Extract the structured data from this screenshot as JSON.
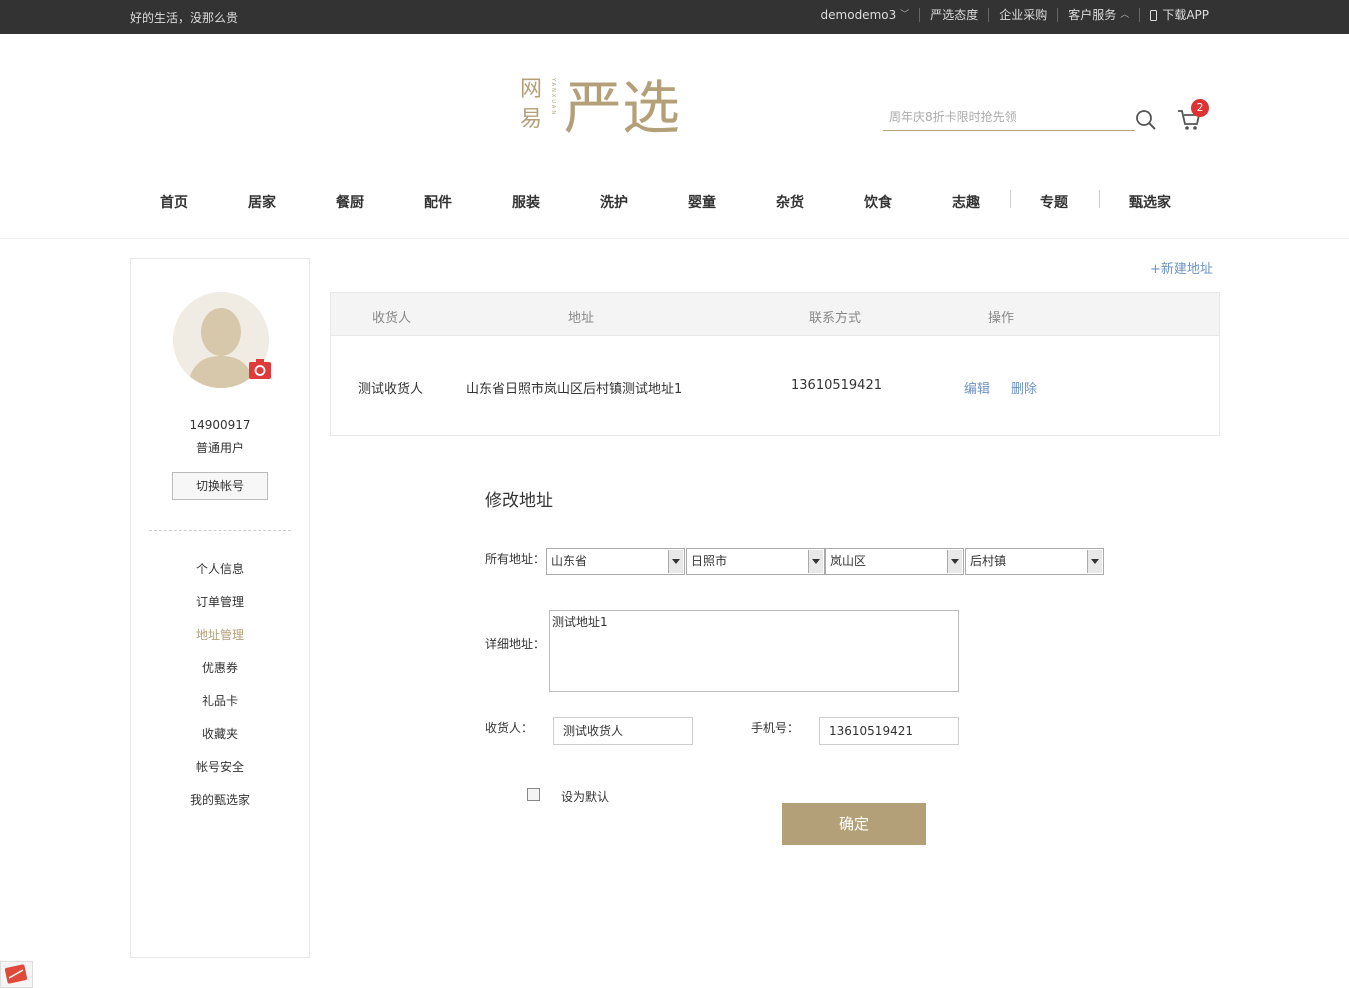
{
  "topbar": {
    "slogan": "好的生活，没那么贵",
    "user": "demodemo3",
    "attitude": "严选态度",
    "enterprise": "企业采购",
    "service": "客户服务",
    "download": "下载APP"
  },
  "header": {
    "logo_small": "网易",
    "logo_pinyin": "YANXUAN",
    "logo_main": "严选",
    "search_placeholder": "周年庆8折卡限时抢先领",
    "cart_count": "2",
    "colors": {
      "brand": "#b4a078",
      "badge": "#d33333",
      "link": "#6b93c4"
    }
  },
  "nav": [
    "首页",
    "居家",
    "餐厨",
    "配件",
    "服装",
    "洗护",
    "婴童",
    "杂货",
    "饮食",
    "志趣",
    "专题",
    "甄选家"
  ],
  "sidebar": {
    "uid": "14900917",
    "user_type": "普通用户",
    "switch_label": "切换帐号",
    "menu": [
      "个人信息",
      "订单管理",
      "地址管理",
      "优惠券",
      "礼品卡",
      "收藏夹",
      "帐号安全",
      "我的甄选家"
    ],
    "active_index": 2
  },
  "address": {
    "new_label": "+新建地址",
    "headers": [
      "收货人",
      "地址",
      "联系方式",
      "操作"
    ],
    "row": {
      "name": "测试收货人",
      "address": "山东省日照市岚山区后村镇测试地址1",
      "phone": "13610519421",
      "edit": "编辑",
      "delete": "删除"
    }
  },
  "form": {
    "title": "修改地址",
    "region_label": "所有地址：",
    "province": "山东省",
    "city": "日照市",
    "district": "岚山区",
    "town": "后村镇",
    "detail_label": "详细地址：",
    "detail_value": "测试地址1",
    "receiver_label": "收货人：",
    "receiver_value": "测试收货人",
    "phone_label": "手机号：",
    "phone_value": "13610519421",
    "default_label": "设为默认",
    "default_checked": false,
    "submit_label": "确定"
  }
}
